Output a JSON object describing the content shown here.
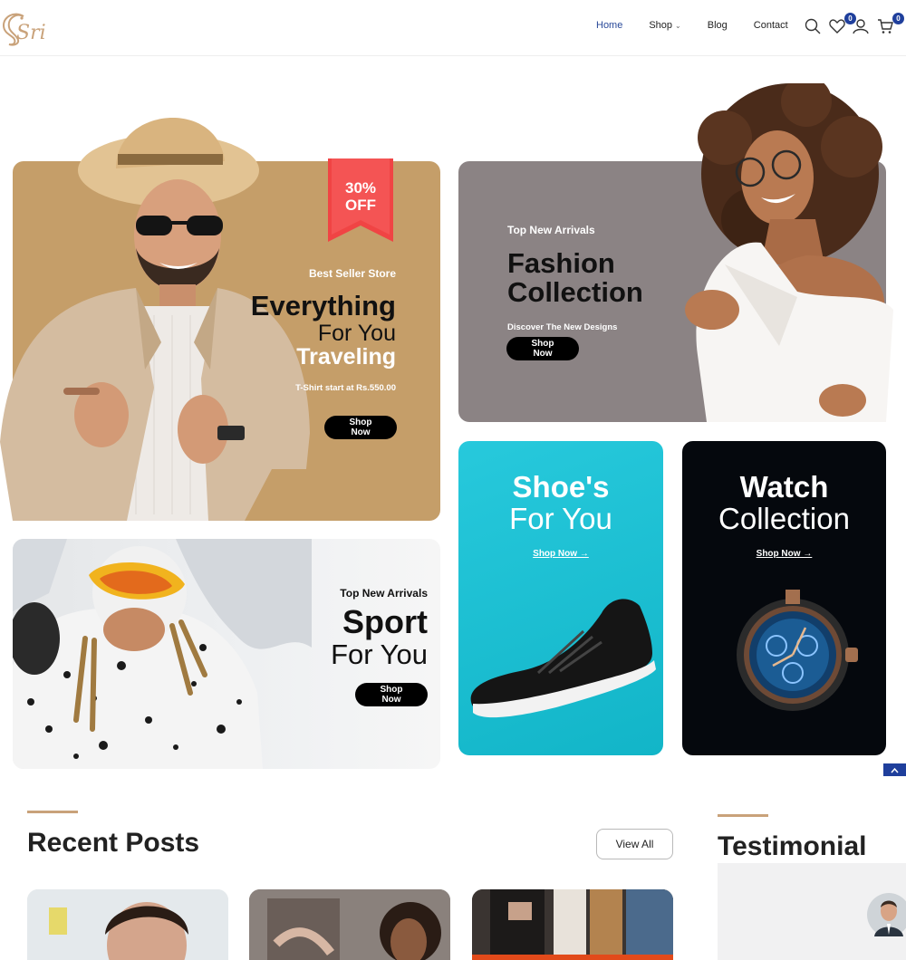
{
  "header": {
    "logo_text": "Sri",
    "nav": [
      {
        "label": "Home",
        "active": true
      },
      {
        "label": "Shop",
        "has_dropdown": true
      },
      {
        "label": "Blog"
      },
      {
        "label": "Contact"
      }
    ],
    "wishlist_count": "0",
    "cart_count": "0",
    "icons": [
      "search-icon",
      "heart-icon",
      "user-icon",
      "cart-icon"
    ]
  },
  "banners": {
    "traveling": {
      "ribbon": "30%\nOFF",
      "kicker": "Best Seller Store",
      "title_bold": "Everything",
      "title_thin": "For You",
      "title_bold2": "Traveling",
      "price_text": "T-Shirt start at Rs.550.00",
      "button": "Shop Now"
    },
    "fashion": {
      "kicker": "Top New Arrivals",
      "title_line1": "Fashion",
      "title_line2": "Collection",
      "subtitle": "Discover The New Designs",
      "button": "Shop Now"
    },
    "sport": {
      "kicker": "Top New Arrivals",
      "title_bold": "Sport",
      "title_thin": "For You",
      "button": "Shop Now"
    },
    "shoes": {
      "title_bold": "Shoe's",
      "title_thin": "For You",
      "link": "Shop Now →"
    },
    "watch": {
      "title_bold": "Watch",
      "title_thin": "Collection",
      "link": "Shop Now →"
    }
  },
  "recent_posts": {
    "title": "Recent Posts",
    "view_all": "View All"
  },
  "testimonial": {
    "title": "Testimonial"
  },
  "colors": {
    "accent": "#c9a27a",
    "brand_blue": "#1f3f9c",
    "traveling_bg": "#c59e69",
    "fashion_bg": "#8b8384",
    "shoes_bg": "#1bbdd0",
    "watch_bg": "#05080d",
    "ribbon": "#f04444"
  }
}
